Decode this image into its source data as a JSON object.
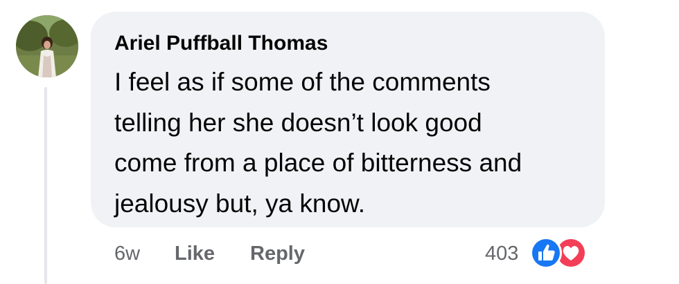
{
  "comment": {
    "author": "Ariel Puffball Thomas",
    "text_lines": [
      "I feel as if some of the comments",
      "telling her she doesn’t look good",
      "come from a place of bitterness and",
      "jealousy but, ya know."
    ]
  },
  "actions": {
    "timestamp": "6w",
    "like_label": "Like",
    "reply_label": "Reply"
  },
  "reactions": {
    "count": "403",
    "types": [
      "like-icon",
      "love-icon"
    ]
  },
  "colors": {
    "bubble_bg": "#f0f2f5",
    "text": "#050505",
    "secondary_text": "#65676b",
    "like_blue": "#1877f2",
    "love_red": "#f33e58",
    "thread_line": "#e4e6eb"
  }
}
